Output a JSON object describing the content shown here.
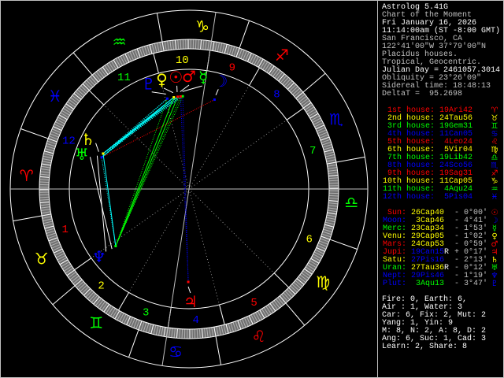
{
  "info": {
    "app": "Astrolog 5.41G",
    "chart": "Chart of the Moment",
    "date": "Fri January 16, 2026",
    "time": "11:14:00am (ST -8:00 GMT)",
    "place": "San Francisco, CA",
    "coords": "122°41'00\"W 37°79'00\"N",
    "houses": "Placidus houses.",
    "zodiac": "Tropical, Geocentric.",
    "julian": "Julian Day = 2461057.3014",
    "obliquity": "Obliquity = 23°26'09\"",
    "sidereal": "Sidereal time: 18:48:13",
    "deltat": "DeltaT =  95.2698"
  },
  "colors": {
    "red": "#ff0000",
    "yellow": "#ffff00",
    "green": "#00ff00",
    "blue": "#0000ff",
    "cyan": "#00ffff",
    "gray": "#c0c0c0"
  },
  "houses": [
    {
      "num": "1",
      "label": "1st house:",
      "pos": "19Ari42",
      "glyph": "♈",
      "color": "#ff0000"
    },
    {
      "num": "2",
      "label": "2nd house:",
      "pos": "24Tau56",
      "glyph": "♉",
      "color": "#ffff00"
    },
    {
      "num": "3",
      "label": "3rd house:",
      "pos": "19Gem31",
      "glyph": "♊",
      "color": "#00ff00"
    },
    {
      "num": "4",
      "label": "4th house:",
      "pos": "11Can05",
      "glyph": "♋",
      "color": "#0000ff"
    },
    {
      "num": "5",
      "label": "5th house:",
      "pos": "4Leo24",
      "glyph": "♌",
      "color": "#ff0000"
    },
    {
      "num": "6",
      "label": "6th house:",
      "pos": "5Vir04",
      "glyph": "♍",
      "color": "#ffff00"
    },
    {
      "num": "7",
      "label": "7th house:",
      "pos": "19Lib42",
      "glyph": "♎",
      "color": "#00ff00"
    },
    {
      "num": "8",
      "label": "8th house:",
      "pos": "24Sco56",
      "glyph": "♏",
      "color": "#0000ff"
    },
    {
      "num": "9",
      "label": "9th house:",
      "pos": "19Sag31",
      "glyph": "♐",
      "color": "#ff0000"
    },
    {
      "num": "10",
      "label": "10th house:",
      "pos": "11Cap05",
      "glyph": "♑",
      "color": "#ffff00"
    },
    {
      "num": "11",
      "label": "11th house:",
      "pos": "4Aqu24",
      "glyph": "♒",
      "color": "#00ff00"
    },
    {
      "num": "12",
      "label": "12th house:",
      "pos": "5Pis04",
      "glyph": "♓",
      "color": "#0000ff"
    }
  ],
  "planets": [
    {
      "name": "Sun:",
      "pos": "26Cap40",
      "retro": "",
      "motion": "- 0°00'",
      "glyph": "☉",
      "color": "#ff0000",
      "pos_color": "#ffff00"
    },
    {
      "name": "Moon:",
      "pos": "3Cap46",
      "retro": "",
      "motion": "- 4°41'",
      "glyph": "☽",
      "color": "#0000ff",
      "pos_color": "#ffff00"
    },
    {
      "name": "Merc:",
      "pos": "23Cap34",
      "retro": "",
      "motion": "- 1°53'",
      "glyph": "☿",
      "color": "#00ff00",
      "pos_color": "#ffff00"
    },
    {
      "name": "Venu:",
      "pos": "29Cap05",
      "retro": "",
      "motion": "- 1°02'",
      "glyph": "♀",
      "color": "#ffff00",
      "pos_color": "#ffff00"
    },
    {
      "name": "Mars:",
      "pos": "24Cap53",
      "retro": "",
      "motion": "- 0°59'",
      "glyph": "♂",
      "color": "#ff0000",
      "pos_color": "#ffff00"
    },
    {
      "name": "Jupi:",
      "pos": "19Can15",
      "retro": "R",
      "motion": "+ 0°17'",
      "glyph": "♃",
      "color": "#ff0000",
      "pos_color": "#0000ff"
    },
    {
      "name": "Satu:",
      "pos": "27Pis16",
      "retro": "",
      "motion": "- 2°13'",
      "glyph": "♄",
      "color": "#ffff00",
      "pos_color": "#0000ff"
    },
    {
      "name": "Uran:",
      "pos": "27Tau36",
      "retro": "R",
      "motion": "- 0°12'",
      "glyph": "♅",
      "color": "#00ff00",
      "pos_color": "#ffff00"
    },
    {
      "name": "Nept:",
      "pos": "29Pis46",
      "retro": "",
      "motion": "- 1°19'",
      "glyph": "♆",
      "color": "#0000ff",
      "pos_color": "#0000ff"
    },
    {
      "name": "Plut:",
      "pos": "3Aqu13",
      "retro": "",
      "motion": "- 3°47'",
      "glyph": "♇",
      "color": "#0000ff",
      "pos_color": "#00ff00"
    }
  ],
  "summary": [
    "Fire: 0, Earth: 6,",
    "Air : 1, Water: 3",
    "Car: 6, Fix: 2, Mut: 2",
    "Yang: 1, Yin: 9",
    "M: 8, N: 2, A: 8, D: 2",
    "Ang: 6, Suc: 1, Cad: 3",
    "Learn: 2, Share: 8"
  ]
}
